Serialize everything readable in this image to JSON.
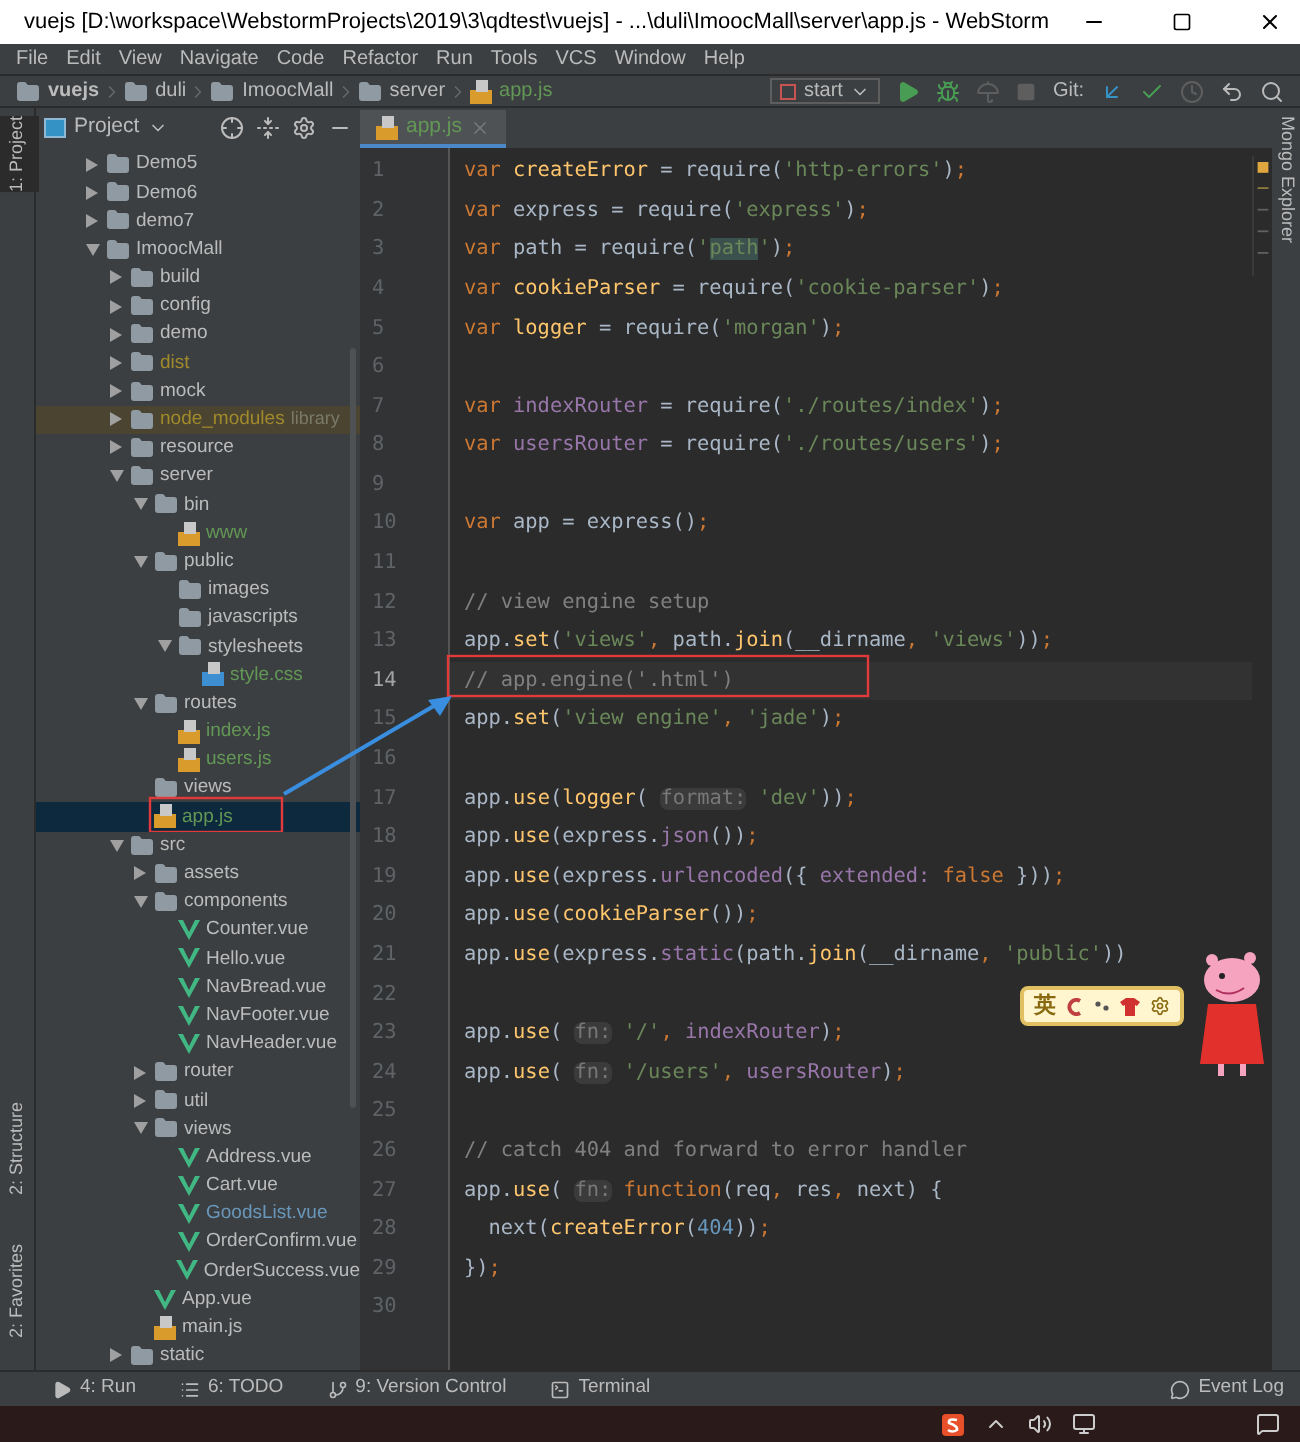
{
  "window": {
    "title": "vuejs [D:\\workspace\\WebstormProjects\\2019\\3\\qdtest\\vuejs] - ...\\duli\\ImoocMall\\server\\app.js - WebStorm"
  },
  "menu": [
    "File",
    "Edit",
    "View",
    "Navigate",
    "Code",
    "Refactor",
    "Run",
    "Tools",
    "VCS",
    "Window",
    "Help"
  ],
  "breadcrumbs": [
    {
      "label": "vuejs",
      "kind": "folder"
    },
    {
      "label": "duli",
      "kind": "folder"
    },
    {
      "label": "ImoocMall",
      "kind": "folder"
    },
    {
      "label": "server",
      "kind": "folder"
    },
    {
      "label": "app.js",
      "kind": "file"
    }
  ],
  "run_config": "start",
  "git_label": "Git:",
  "side_tabs_left": [
    {
      "label": "1: Project",
      "selected": true
    },
    {
      "label": "2: Structure",
      "selected": false
    },
    {
      "label": "2: Favorites",
      "selected": false
    }
  ],
  "side_tabs_right": [
    {
      "label": "Mongo Explorer",
      "selected": false
    }
  ],
  "project_panel": {
    "title": "Project"
  },
  "tree": [
    {
      "name": "Demo5",
      "kind": "folder",
      "expanded": false,
      "selected": false,
      "color": "#bbbbbb"
    },
    {
      "name": "Demo6",
      "kind": "folder",
      "expanded": false,
      "selected": false,
      "color": "#bbbbbb"
    },
    {
      "name": "demo7",
      "kind": "folder",
      "expanded": false,
      "selected": false,
      "color": "#bbbbbb"
    },
    {
      "name": "ImoocMall",
      "kind": "folder",
      "expanded": true,
      "selected": false,
      "color": "#bbbbbb",
      "children": [
        {
          "name": "build",
          "kind": "folder",
          "expanded": false,
          "selected": false,
          "color": "#bbbbbb"
        },
        {
          "name": "config",
          "kind": "folder",
          "expanded": false,
          "selected": false,
          "color": "#bbbbbb"
        },
        {
          "name": "demo",
          "kind": "folder",
          "expanded": false,
          "selected": false,
          "color": "#bbbbbb"
        },
        {
          "name": "dist",
          "kind": "folder",
          "expanded": false,
          "selected": false,
          "color": "#a08a2c"
        },
        {
          "name": "mock",
          "kind": "folder",
          "expanded": false,
          "selected": false,
          "color": "#bbbbbb"
        },
        {
          "name": "node_modules",
          "note": "library",
          "library": true,
          "kind": "folder",
          "expanded": false,
          "selected": false,
          "color": "#a08a2c"
        },
        {
          "name": "resource",
          "kind": "folder",
          "expanded": false,
          "selected": false,
          "color": "#bbbbbb"
        },
        {
          "name": "server",
          "kind": "folder",
          "expanded": true,
          "selected": false,
          "color": "#bbbbbb",
          "children": [
            {
              "name": "bin",
              "kind": "folder",
              "expanded": true,
              "selected": false,
              "color": "#bbbbbb",
              "children": [
                {
                  "name": "www",
                  "kind": "js",
                  "selected": false,
                  "color": "#629755"
                }
              ]
            },
            {
              "name": "public",
              "kind": "folder",
              "expanded": true,
              "selected": false,
              "color": "#bbbbbb",
              "children": [
                {
                  "name": "images",
                  "kind": "folder",
                  "selected": false,
                  "color": "#bbbbbb"
                },
                {
                  "name": "javascripts",
                  "kind": "folder",
                  "selected": false,
                  "color": "#bbbbbb"
                },
                {
                  "name": "stylesheets",
                  "kind": "folder",
                  "expanded": true,
                  "selected": false,
                  "color": "#bbbbbb",
                  "children": [
                    {
                      "name": "style.css",
                      "kind": "css",
                      "selected": false,
                      "color": "#629755"
                    }
                  ]
                }
              ]
            },
            {
              "name": "routes",
              "kind": "folder",
              "expanded": true,
              "selected": false,
              "color": "#bbbbbb",
              "children": [
                {
                  "name": "index.js",
                  "kind": "js",
                  "selected": false,
                  "color": "#629755"
                },
                {
                  "name": "users.js",
                  "kind": "js",
                  "selected": false,
                  "color": "#629755"
                }
              ]
            },
            {
              "name": "views",
              "kind": "folder",
              "selected": false,
              "color": "#bbbbbb"
            },
            {
              "name": "app.js",
              "kind": "js",
              "selected": true,
              "color": "#629755"
            }
          ]
        },
        {
          "name": "src",
          "kind": "folder",
          "expanded": true,
          "selected": false,
          "color": "#bbbbbb",
          "children": [
            {
              "name": "assets",
              "kind": "folder",
              "expanded": false,
              "selected": false,
              "color": "#bbbbbb"
            },
            {
              "name": "components",
              "kind": "folder",
              "expanded": true,
              "selected": false,
              "color": "#bbbbbb",
              "children": [
                {
                  "name": "Counter.vue",
                  "kind": "vue",
                  "selected": false,
                  "color": "#bbbbbb"
                },
                {
                  "name": "Hello.vue",
                  "kind": "vue",
                  "selected": false,
                  "color": "#bbbbbb"
                },
                {
                  "name": "NavBread.vue",
                  "kind": "vue",
                  "selected": false,
                  "color": "#bbbbbb"
                },
                {
                  "name": "NavFooter.vue",
                  "kind": "vue",
                  "selected": false,
                  "color": "#bbbbbb"
                },
                {
                  "name": "NavHeader.vue",
                  "kind": "vue",
                  "selected": false,
                  "color": "#bbbbbb"
                }
              ]
            },
            {
              "name": "router",
              "kind": "folder",
              "expanded": false,
              "selected": false,
              "color": "#bbbbbb"
            },
            {
              "name": "util",
              "kind": "folder",
              "expanded": false,
              "selected": false,
              "color": "#bbbbbb"
            },
            {
              "name": "views",
              "kind": "folder",
              "expanded": true,
              "selected": false,
              "color": "#bbbbbb",
              "children": [
                {
                  "name": "Address.vue",
                  "kind": "vue",
                  "selected": false,
                  "color": "#bbbbbb"
                },
                {
                  "name": "Cart.vue",
                  "kind": "vue",
                  "selected": false,
                  "color": "#bbbbbb"
                },
                {
                  "name": "GoodsList.vue",
                  "kind": "vue",
                  "selected": false,
                  "color": "#6897bb"
                },
                {
                  "name": "OrderConfirm.vue",
                  "kind": "vue",
                  "selected": false,
                  "color": "#bbbbbb"
                },
                {
                  "name": "OrderSuccess.vue",
                  "kind": "vue",
                  "selected": false,
                  "color": "#bbbbbb"
                }
              ]
            },
            {
              "name": "App.vue",
              "kind": "vue",
              "selected": false,
              "color": "#bbbbbb"
            },
            {
              "name": "main.js",
              "kind": "js",
              "selected": false,
              "color": "#bbbbbb"
            }
          ]
        },
        {
          "name": "static",
          "kind": "folder",
          "expanded": false,
          "selected": false,
          "color": "#bbbbbb"
        }
      ]
    }
  ],
  "editor_tab": {
    "label": "app.js"
  },
  "code": [
    {
      "number": "1",
      "current": false,
      "tokens": [
        {
          "t": "var",
          "kind": "kw"
        },
        {
          "t": " createError",
          "kind": "decl"
        },
        {
          "t": " = require(",
          "kind": "plain"
        },
        {
          "t": "'http-errors'",
          "kind": "str"
        },
        {
          "t": ")",
          "kind": "plain"
        },
        {
          "t": ";",
          "kind": "punct"
        }
      ]
    },
    {
      "number": "2",
      "current": false,
      "tokens": [
        {
          "t": "var",
          "kind": "kw"
        },
        {
          "t": " express = require(",
          "kind": "plain"
        },
        {
          "t": "'express'",
          "kind": "str"
        },
        {
          "t": ")",
          "kind": "plain"
        },
        {
          "t": ";",
          "kind": "punct"
        }
      ]
    },
    {
      "number": "3",
      "current": false,
      "tokens": [
        {
          "t": "var",
          "kind": "kw"
        },
        {
          "t": " path = require(",
          "kind": "plain"
        },
        {
          "t": "'",
          "kind": "str"
        },
        {
          "t": "path",
          "kind": "match"
        },
        {
          "t": "'",
          "kind": "str"
        },
        {
          "t": ")",
          "kind": "plain"
        },
        {
          "t": ";",
          "kind": "punct"
        }
      ]
    },
    {
      "number": "4",
      "current": false,
      "tokens": [
        {
          "t": "var",
          "kind": "kw"
        },
        {
          "t": " cookieParser",
          "kind": "decl"
        },
        {
          "t": " = require(",
          "kind": "plain"
        },
        {
          "t": "'cookie-parser'",
          "kind": "str"
        },
        {
          "t": ")",
          "kind": "plain"
        },
        {
          "t": ";",
          "kind": "punct"
        }
      ]
    },
    {
      "number": "5",
      "current": false,
      "tokens": [
        {
          "t": "var",
          "kind": "kw"
        },
        {
          "t": " logger",
          "kind": "decl"
        },
        {
          "t": " = require(",
          "kind": "plain"
        },
        {
          "t": "'morgan'",
          "kind": "str"
        },
        {
          "t": ")",
          "kind": "plain"
        },
        {
          "t": ";",
          "kind": "punct"
        }
      ]
    },
    {
      "number": "6",
      "current": false
    },
    {
      "number": "7",
      "current": false,
      "tokens": [
        {
          "t": "var",
          "kind": "kw"
        },
        {
          "t": " indexRouter",
          "kind": "field"
        },
        {
          "t": " = require(",
          "kind": "plain"
        },
        {
          "t": "'./routes/index'",
          "kind": "str"
        },
        {
          "t": ")",
          "kind": "plain"
        },
        {
          "t": ";",
          "kind": "punct"
        }
      ]
    },
    {
      "number": "8",
      "current": false,
      "tokens": [
        {
          "t": "var",
          "kind": "kw"
        },
        {
          "t": " usersRouter",
          "kind": "field"
        },
        {
          "t": " = require(",
          "kind": "plain"
        },
        {
          "t": "'./routes/users'",
          "kind": "str"
        },
        {
          "t": ")",
          "kind": "plain"
        },
        {
          "t": ";",
          "kind": "punct"
        }
      ]
    },
    {
      "number": "9",
      "current": false
    },
    {
      "number": "10",
      "current": false,
      "tokens": [
        {
          "t": "var",
          "kind": "kw"
        },
        {
          "t": " app = express()",
          "kind": "plain"
        },
        {
          "t": ";",
          "kind": "punct"
        }
      ]
    },
    {
      "number": "11",
      "current": false
    },
    {
      "number": "12",
      "current": false,
      "tokens": [
        {
          "t": "// view engine setup",
          "kind": "comment"
        }
      ]
    },
    {
      "number": "13",
      "current": false,
      "tokens": [
        {
          "t": "app.",
          "kind": "plain"
        },
        {
          "t": "set",
          "kind": "method"
        },
        {
          "t": "(",
          "kind": "plain"
        },
        {
          "t": "'views'",
          "kind": "str"
        },
        {
          "t": ",",
          "kind": "punct"
        },
        {
          "t": " path.",
          "kind": "plain"
        },
        {
          "t": "join",
          "kind": "method"
        },
        {
          "t": "(__dirname",
          "kind": "plain"
        },
        {
          "t": ",",
          "kind": "punct"
        },
        {
          "t": " 'views'",
          "kind": "str"
        },
        {
          "t": "))",
          "kind": "plain"
        },
        {
          "t": ";",
          "kind": "punct"
        }
      ]
    },
    {
      "number": "14",
      "current": true,
      "tokens": [
        {
          "t": "// app.engine('.html')",
          "kind": "comment"
        }
      ]
    },
    {
      "number": "15",
      "current": false,
      "tokens": [
        {
          "t": "app.",
          "kind": "plain"
        },
        {
          "t": "set",
          "kind": "method"
        },
        {
          "t": "(",
          "kind": "plain"
        },
        {
          "t": "'view engine'",
          "kind": "str"
        },
        {
          "t": ",",
          "kind": "punct"
        },
        {
          "t": " 'jade'",
          "kind": "str"
        },
        {
          "t": ")",
          "kind": "plain"
        },
        {
          "t": ";",
          "kind": "punct"
        }
      ]
    },
    {
      "number": "16",
      "current": false
    },
    {
      "number": "17",
      "current": false,
      "tokens": [
        {
          "t": "app.",
          "kind": "plain"
        },
        {
          "t": "use",
          "kind": "method"
        },
        {
          "t": "(",
          "kind": "plain"
        },
        {
          "t": "logger",
          "kind": "decl"
        },
        {
          "t": "( ",
          "kind": "plain"
        },
        {
          "t": "format:",
          "kind": "hint"
        },
        {
          "t": " 'dev'",
          "kind": "str"
        },
        {
          "t": "))",
          "kind": "plain"
        },
        {
          "t": ";",
          "kind": "punct"
        }
      ]
    },
    {
      "number": "18",
      "current": false,
      "tokens": [
        {
          "t": "app.",
          "kind": "plain"
        },
        {
          "t": "use",
          "kind": "method"
        },
        {
          "t": "(express.",
          "kind": "plain"
        },
        {
          "t": "json",
          "kind": "field"
        },
        {
          "t": "())",
          "kind": "plain"
        },
        {
          "t": ";",
          "kind": "punct"
        }
      ]
    },
    {
      "number": "19",
      "current": false,
      "tokens": [
        {
          "t": "app.",
          "kind": "plain"
        },
        {
          "t": "use",
          "kind": "method"
        },
        {
          "t": "(express.",
          "kind": "plain"
        },
        {
          "t": "urlencoded",
          "kind": "field"
        },
        {
          "t": "({ ",
          "kind": "plain"
        },
        {
          "t": "extended:",
          "kind": "field"
        },
        {
          "t": " false",
          "kind": "kw"
        },
        {
          "t": " }))",
          "kind": "plain"
        },
        {
          "t": ";",
          "kind": "punct"
        }
      ]
    },
    {
      "number": "20",
      "current": false,
      "tokens": [
        {
          "t": "app.",
          "kind": "plain"
        },
        {
          "t": "use",
          "kind": "method"
        },
        {
          "t": "(",
          "kind": "plain"
        },
        {
          "t": "cookieParser",
          "kind": "decl"
        },
        {
          "t": "())",
          "kind": "plain"
        },
        {
          "t": ";",
          "kind": "punct"
        }
      ]
    },
    {
      "number": "21",
      "current": false,
      "tokens": [
        {
          "t": "app.",
          "kind": "plain"
        },
        {
          "t": "use",
          "kind": "method"
        },
        {
          "t": "(express.",
          "kind": "plain"
        },
        {
          "t": "static",
          "kind": "field"
        },
        {
          "t": "(path.",
          "kind": "plain"
        },
        {
          "t": "join",
          "kind": "method"
        },
        {
          "t": "(__dirname",
          "kind": "plain"
        },
        {
          "t": ",",
          "kind": "punct"
        },
        {
          "t": " 'public'",
          "kind": "str"
        },
        {
          "t": "))",
          "kind": "plain"
        }
      ]
    },
    {
      "number": "22",
      "current": false
    },
    {
      "number": "23",
      "current": false,
      "tokens": [
        {
          "t": "app.",
          "kind": "plain"
        },
        {
          "t": "use",
          "kind": "method"
        },
        {
          "t": "( ",
          "kind": "plain"
        },
        {
          "t": "fn:",
          "kind": "hint"
        },
        {
          "t": " '/'",
          "kind": "str"
        },
        {
          "t": ",",
          "kind": "punct"
        },
        {
          "t": " indexRouter",
          "kind": "field"
        },
        {
          "t": ")",
          "kind": "plain"
        },
        {
          "t": ";",
          "kind": "punct"
        }
      ]
    },
    {
      "number": "24",
      "current": false,
      "tokens": [
        {
          "t": "app.",
          "kind": "plain"
        },
        {
          "t": "use",
          "kind": "method"
        },
        {
          "t": "( ",
          "kind": "plain"
        },
        {
          "t": "fn:",
          "kind": "hint"
        },
        {
          "t": " '/users'",
          "kind": "str"
        },
        {
          "t": ",",
          "kind": "punct"
        },
        {
          "t": " usersRouter",
          "kind": "field"
        },
        {
          "t": ")",
          "kind": "plain"
        },
        {
          "t": ";",
          "kind": "punct"
        }
      ]
    },
    {
      "number": "25",
      "current": false
    },
    {
      "number": "26",
      "current": false,
      "tokens": [
        {
          "t": "// catch 404 and forward to error handler",
          "kind": "comment"
        }
      ]
    },
    {
      "number": "27",
      "current": false,
      "tokens": [
        {
          "t": "app.",
          "kind": "plain"
        },
        {
          "t": "use",
          "kind": "method"
        },
        {
          "t": "( ",
          "kind": "plain"
        },
        {
          "t": "fn:",
          "kind": "hint"
        },
        {
          "t": " function",
          "kind": "kw"
        },
        {
          "t": "(req",
          "kind": "plain"
        },
        {
          "t": ",",
          "kind": "punct"
        },
        {
          "t": " res",
          "kind": "plain"
        },
        {
          "t": ",",
          "kind": "punct"
        },
        {
          "t": " next) {",
          "kind": "plain"
        }
      ]
    },
    {
      "number": "28",
      "current": false,
      "tokens": [
        {
          "t": "  next(",
          "kind": "plain"
        },
        {
          "t": "createError",
          "kind": "decl"
        },
        {
          "t": "(",
          "kind": "plain"
        },
        {
          "t": "404",
          "kind": "num"
        },
        {
          "t": "))",
          "kind": "plain"
        },
        {
          "t": ";",
          "kind": "punct"
        }
      ]
    },
    {
      "number": "29",
      "current": false,
      "tokens": [
        {
          "t": "})",
          "kind": "plain"
        },
        {
          "t": ";",
          "kind": "punct"
        }
      ]
    },
    {
      "number": "30",
      "current": false
    }
  ],
  "ime_toolbar": {
    "label": "英"
  },
  "bottom_tools": [
    {
      "label": "4: Run",
      "kind": "run"
    },
    {
      "label": "6: TODO",
      "kind": "todo"
    },
    {
      "label": "9: Version Control",
      "kind": "vcs"
    },
    {
      "label": "Terminal",
      "kind": "terminal"
    }
  ],
  "event_log": "Event Log"
}
